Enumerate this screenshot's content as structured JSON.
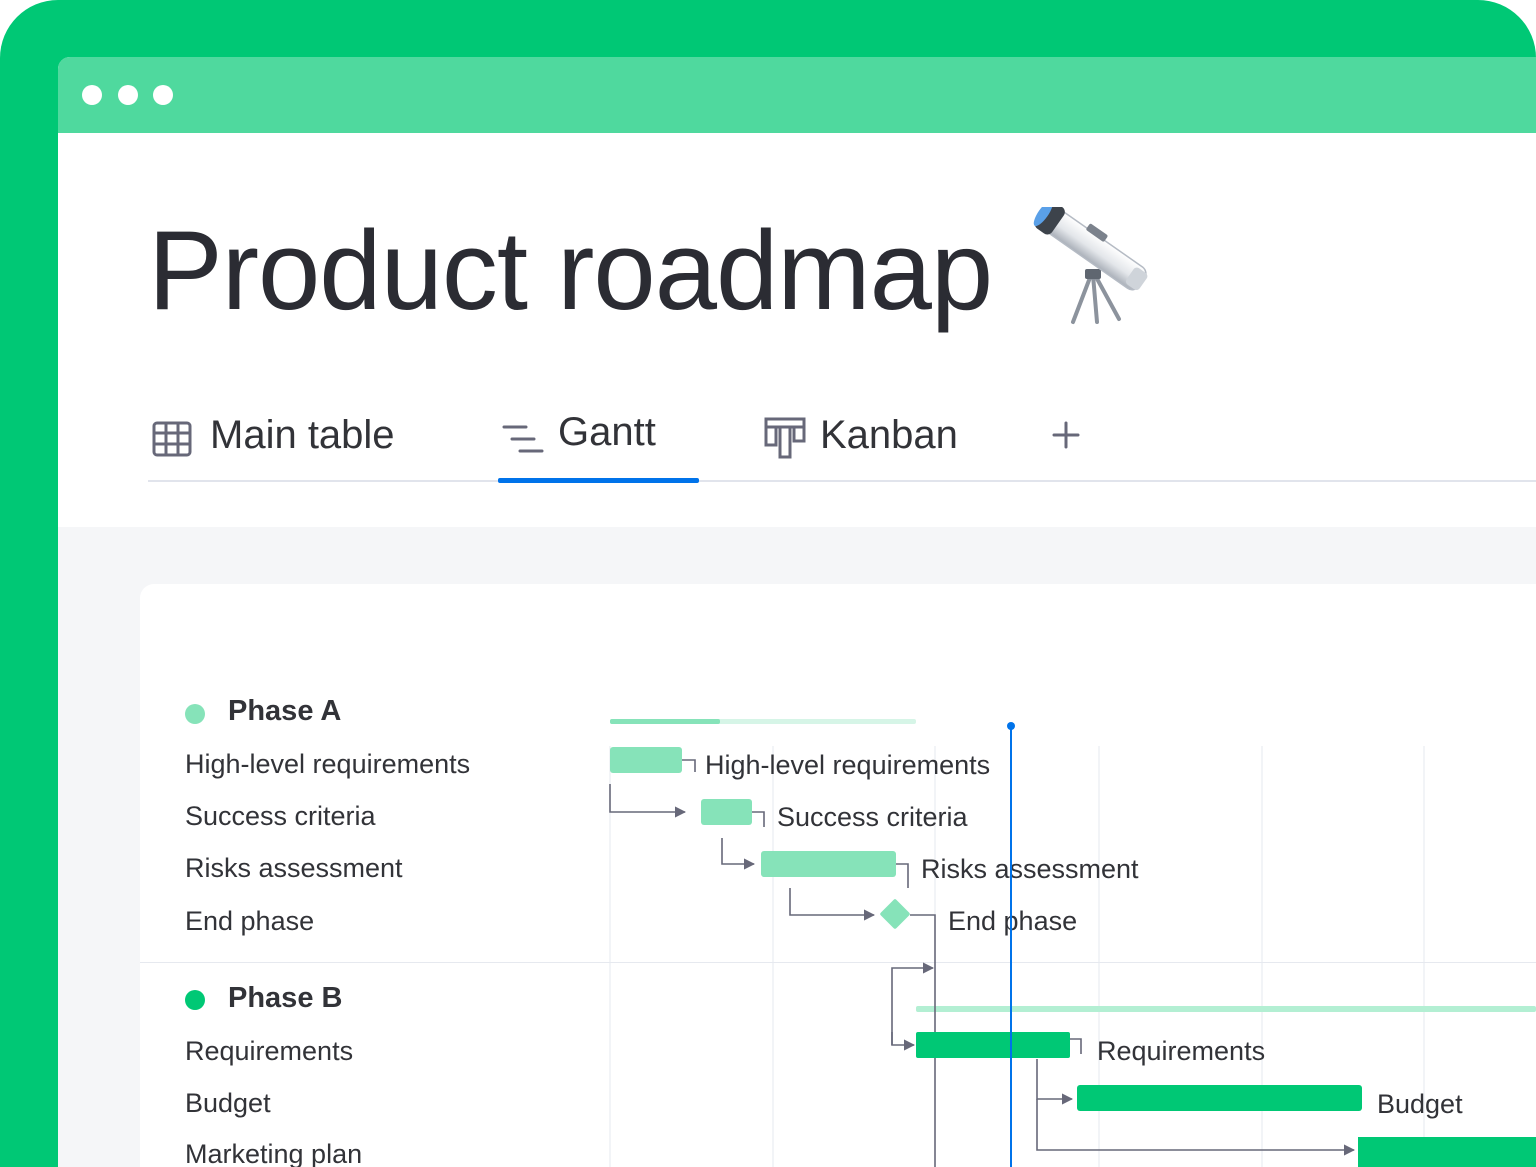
{
  "page": {
    "title": "Product roadmap",
    "title_icon": "telescope-icon"
  },
  "window_controls": [
    "dot",
    "dot",
    "dot"
  ],
  "tabs": [
    {
      "label": "Main table",
      "icon": "table-icon",
      "active": false
    },
    {
      "label": "Gantt",
      "icon": "gantt-icon",
      "active": true
    },
    {
      "label": "Kanban",
      "icon": "kanban-icon",
      "active": false
    }
  ],
  "add_view_icon": "plus-icon",
  "colors": {
    "frame": "#00c875",
    "titlebar": "#4fd99e",
    "phase_a": "#86e3b9",
    "phase_b": "#00c875",
    "today_line": "#0073ea",
    "tab_active": "#0073ea"
  },
  "groups": [
    {
      "name": "Phase A",
      "color": "#86e3b9",
      "progress": 0.36,
      "items": [
        {
          "name": "High-level requirements",
          "type": "task"
        },
        {
          "name": "Success criteria",
          "type": "task"
        },
        {
          "name": "Risks assessment",
          "type": "task"
        },
        {
          "name": "End phase",
          "type": "milestone"
        }
      ]
    },
    {
      "name": "Phase B",
      "color": "#00c875",
      "items": [
        {
          "name": "Requirements",
          "type": "task"
        },
        {
          "name": "Budget",
          "type": "task"
        },
        {
          "name": "Marketing plan",
          "type": "task"
        }
      ]
    }
  ]
}
